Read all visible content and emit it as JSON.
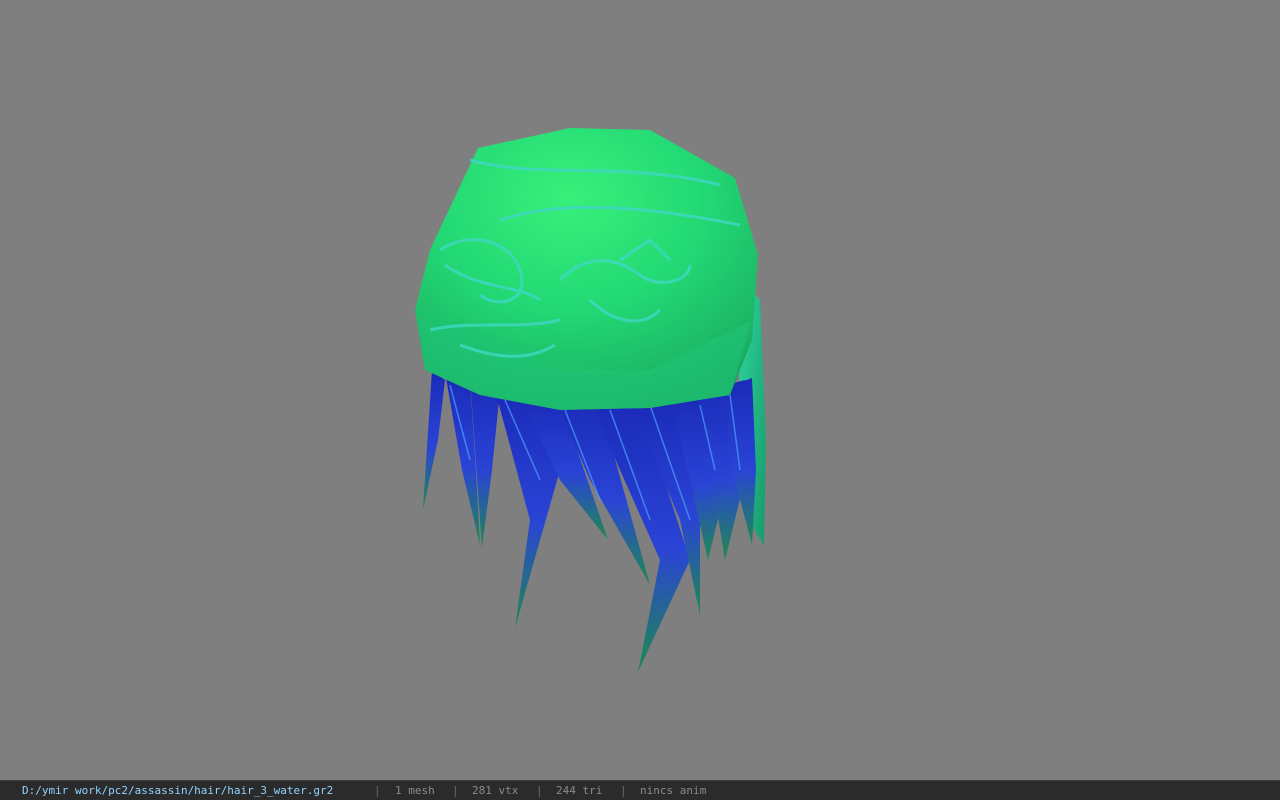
{
  "viewer": {
    "background_color": "#7f7f7f",
    "model_colors": {
      "cap_light": "#2fe07a",
      "cap_dark": "#1fb86a",
      "pattern": "#3fd8b8",
      "strands_blue": "#2233cc",
      "strands_green": "#1f8f55"
    }
  },
  "statusbar": {
    "file_path": "D:/ymir work/pc2/assassin/hair/hair_3_water.gr2",
    "separator": "|",
    "mesh_count": "1 mesh",
    "vertex_count": "281 vtx",
    "triangle_count": "244 tri",
    "anim_status": "nincs anim"
  }
}
